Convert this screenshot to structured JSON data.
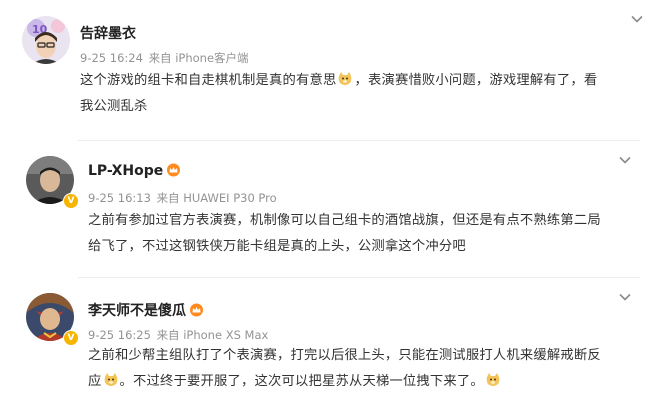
{
  "comments": [
    {
      "username": "告辞墨衣",
      "time": "9-25 16:24",
      "source": "来自 iPhone客户端",
      "text_a": "这个游戏的组卡和自走棋机制是真的有意思",
      "text_b": "，表演赛惜败小问题，游戏理解有了，看",
      "text_c": "我公测乱杀",
      "emoji": "doge-emoji"
    },
    {
      "username": "LP-XHope",
      "time": "9-25 16:13",
      "source": "来自 HUAWEI P30 Pro",
      "text_a": "之前有参加过官方表演赛，机制像可以自己组卡的酒馆战旗，但还是有点不熟练第二局",
      "text_b": "给飞了，不过这钢铁侠万能卡组是真的上头，公测拿这个冲分吧",
      "verified": true,
      "badge": "crown-icon"
    },
    {
      "username": "李天师不是傻瓜",
      "time": "9-25 16:25",
      "source": "来自 iPhone XS Max",
      "text_a": "之前和少帮主组队打了个表演赛，打完以后很上头，只能在测试服打人机来缓解戒断反",
      "text_b": "应",
      "text_c": "。不过终于要开服了，这次可以把星苏从天梯一位拽下来了。",
      "verified": true,
      "badge": "crown-icon",
      "emoji": "doge-emoji"
    }
  ],
  "colors": {
    "meta": "#939393",
    "name": "#222222",
    "verified_badge": "#f7b500",
    "divider": "#ececec"
  }
}
